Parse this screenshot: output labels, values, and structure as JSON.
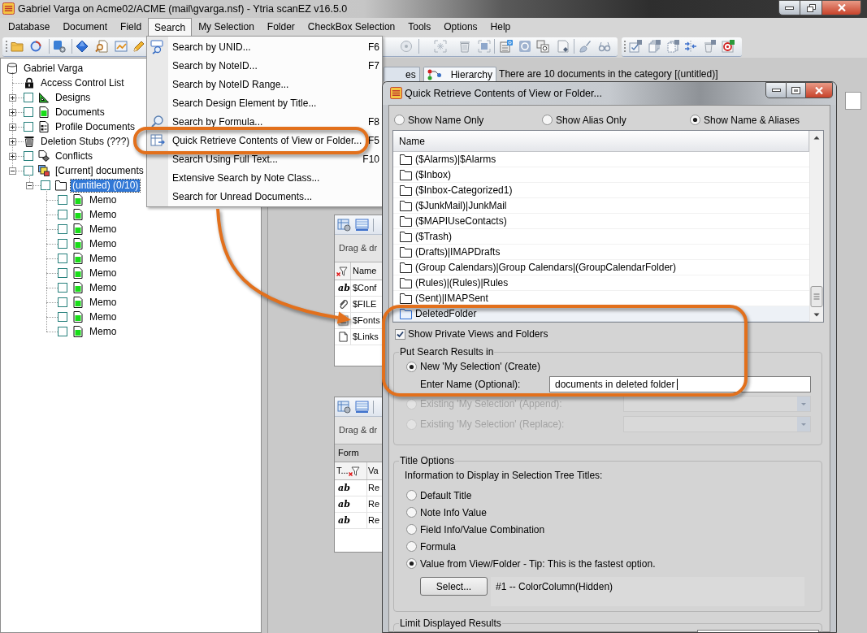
{
  "window": {
    "title": "Gabriel Varga on Acme02/ACME (mail\\gvarga.nsf) - Ytria scanEZ v16.5.0"
  },
  "menu_bar": [
    {
      "label": "Database",
      "selected": false
    },
    {
      "label": "Document",
      "selected": false
    },
    {
      "label": "Field",
      "selected": false
    },
    {
      "label": "Search",
      "selected": true
    },
    {
      "label": "My Selection",
      "selected": false
    },
    {
      "label": "Folder",
      "selected": false
    },
    {
      "label": "CheckBox Selection",
      "selected": false
    },
    {
      "label": "Tools",
      "selected": false
    },
    {
      "label": "Options",
      "selected": false
    },
    {
      "label": "Help",
      "selected": false
    }
  ],
  "search_menu": [
    {
      "label": "Search by UNID...",
      "shortcut": "F6",
      "kind": "unid"
    },
    {
      "label": "Search by NoteID...",
      "shortcut": "F7",
      "kind": "plain"
    },
    {
      "label": "Search by NoteID Range...",
      "kind": "plain"
    },
    {
      "label": "Search Design Element by Title...",
      "kind": "plain"
    },
    {
      "label": "Search by Formula...",
      "shortcut": "F8",
      "kind": "formula"
    },
    {
      "label": "Quick Retrieve Contents of View or Folder...",
      "shortcut": "F5",
      "kind": "view"
    },
    {
      "label": "Search Using Full Text...",
      "shortcut": "F10",
      "kind": "plain"
    },
    {
      "label": "Extensive Search by Note Class...",
      "kind": "plain"
    },
    {
      "label": "Search for Unread Documents...",
      "kind": "plain"
    }
  ],
  "tree": {
    "label": "Gabriel Varga",
    "kind": "database",
    "selected": false,
    "children": [
      {
        "label": "Access Control List",
        "kind": "acl",
        "selected": false
      },
      {
        "label": "Designs",
        "kind": "design",
        "selected": false,
        "expanded": false,
        "checked": false
      },
      {
        "label": "Documents",
        "kind": "documents",
        "selected": false,
        "expanded": false,
        "checked": false
      },
      {
        "label": "Profile Documents",
        "kind": "profile",
        "selected": false,
        "expanded": false,
        "checked": false
      },
      {
        "label": "Deletion Stubs (???)",
        "kind": "stubs",
        "selected": false,
        "expanded": false
      },
      {
        "label": "Conflicts",
        "kind": "conflicts",
        "selected": false,
        "expanded": false,
        "checked": false
      },
      {
        "label": "[Current] documents",
        "kind": "category",
        "selected": false,
        "expanded": true,
        "checked": false,
        "children": [
          {
            "label": "(untitled) (0/10)",
            "kind": "folder",
            "selected": true,
            "expanded": true,
            "checked": false,
            "children": [
              {
                "label": "Memo",
                "kind": "memo",
                "selected": false,
                "checked": false
              },
              {
                "label": "Memo",
                "kind": "memo",
                "selected": false,
                "checked": false
              },
              {
                "label": "Memo",
                "kind": "memo",
                "selected": false,
                "checked": false
              },
              {
                "label": "Memo",
                "kind": "memo",
                "selected": false,
                "checked": false
              },
              {
                "label": "Memo",
                "kind": "memo",
                "selected": false,
                "checked": false
              },
              {
                "label": "Memo",
                "kind": "memo",
                "selected": false,
                "checked": false
              },
              {
                "label": "Memo",
                "kind": "memo",
                "selected": false,
                "checked": false
              },
              {
                "label": "Memo",
                "kind": "memo",
                "selected": false,
                "checked": false
              },
              {
                "label": "Memo",
                "kind": "memo",
                "selected": false,
                "checked": false
              },
              {
                "label": "Memo",
                "kind": "memo",
                "selected": false,
                "checked": false
              }
            ]
          }
        ]
      }
    ]
  },
  "view_tabs": [
    {
      "label": "es",
      "kind": "plain",
      "selected": false
    },
    {
      "label": "Hierarchy",
      "kind": "hierarchy",
      "selected": true
    }
  ],
  "category_info": "There are 10 documents in the category [(untitled)]",
  "field_panels": [
    {
      "title": "Drag & dr",
      "value_column_label": "Name",
      "rows": [
        {
          "kind": "text",
          "type_label": "ab",
          "name": "$Conf"
        },
        {
          "kind": "attachment",
          "name": "$FILE"
        },
        {
          "kind": "list",
          "name": "$Fonts"
        },
        {
          "kind": "page",
          "name": "$Links"
        }
      ]
    },
    {
      "title": "Drag & dr",
      "group_label": "Form",
      "type_column_label": "T...",
      "value_column_label": "Va",
      "rows": [
        {
          "kind": "text",
          "type_label": "ab",
          "name": "Re"
        },
        {
          "kind": "text",
          "type_label": "ab",
          "name": "Re"
        },
        {
          "kind": "text",
          "type_label": "ab",
          "name": "Re"
        }
      ]
    }
  ],
  "dialog": {
    "title": "Quick Retrieve Contents of View or Folder...",
    "display_modes": [
      {
        "label": "Show Name Only",
        "selected": false
      },
      {
        "label": "Show Alias Only",
        "selected": false
      },
      {
        "label": "Show Name & Aliases",
        "selected": true
      }
    ],
    "list": {
      "column": "Name",
      "rows": [
        {
          "name": "($Alarms)|$Alarms",
          "selected": false
        },
        {
          "name": "($Inbox)",
          "selected": false
        },
        {
          "name": "($Inbox-Categorized1)",
          "selected": false
        },
        {
          "name": "($JunkMail)|JunkMail",
          "selected": false
        },
        {
          "name": "($MAPIUseContacts)",
          "selected": false
        },
        {
          "name": "($Trash)",
          "selected": false
        },
        {
          "name": "(Drafts)|IMAPDrafts",
          "selected": false
        },
        {
          "name": "(Group Calendars)|Group Calendars|(GroupCalendarFolder)",
          "selected": false
        },
        {
          "name": "(Rules)|(Rules)|Rules",
          "selected": false
        },
        {
          "name": "(Sent)|IMAPSent",
          "selected": false
        },
        {
          "name": "DeletedFolder",
          "selected": true
        }
      ]
    },
    "show_private": {
      "label": "Show Private Views and Folders",
      "checked": true
    },
    "results_group": {
      "title": "Put Search Results in",
      "options": [
        {
          "kind": "plain",
          "label": "New 'My Selection' (Create)",
          "selected": true,
          "disabled": false
        },
        {
          "kind": "dropdown",
          "label": "Existing 'My Selection' (Append):",
          "selected": false,
          "disabled": true
        },
        {
          "kind": "dropdown",
          "label": "Existing 'My Selection' (Replace):",
          "selected": false,
          "disabled": true
        }
      ],
      "name_field": {
        "label": "Enter Name (Optional):",
        "value": "documents in deleted folder"
      }
    },
    "title_group": {
      "title": "Title Options",
      "hint": "Information to Display in Selection Tree Titles:",
      "options": [
        {
          "label": "Default Title",
          "selected": false
        },
        {
          "label": "Note Info Value",
          "selected": false
        },
        {
          "label": "Field Info/Value Combination",
          "selected": false
        },
        {
          "label": "Formula",
          "selected": false
        },
        {
          "label": "Value from View/Folder - Tip: This is the fastest option.",
          "selected": true
        }
      ],
      "button": "Select...",
      "selection": "#1 -- ColorColumn(Hidden)"
    },
    "limit_group": {
      "title": "Limit Displayed Results"
    }
  }
}
